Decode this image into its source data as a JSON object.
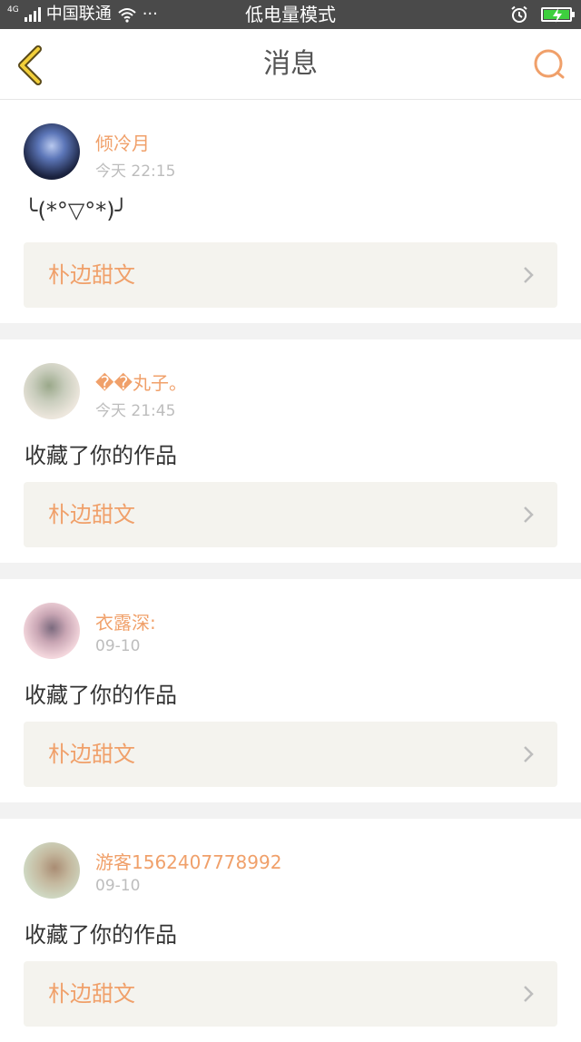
{
  "status_bar": {
    "network": "4G",
    "carrier": "中国联通",
    "dots": "···",
    "mode": "低电量模式"
  },
  "header": {
    "title": "消息"
  },
  "messages": [
    {
      "user": "倾冷月",
      "time": "今天 22:15",
      "text": "╰(*°▽°*)╯",
      "work_title": "朴边甜文",
      "avatar_colors": [
        "#1b2340",
        "#6f88c9"
      ]
    },
    {
      "user": "��丸子。",
      "time": "今天 21:45",
      "text": "收藏了你的作品",
      "work_title": "朴边甜文",
      "avatar_colors": [
        "#e9e1d7",
        "#9aa88a"
      ]
    },
    {
      "user": "衣露深:",
      "time": "09-10",
      "text": "收藏了你的作品",
      "work_title": "朴边甜文",
      "avatar_colors": [
        "#f3d6dc",
        "#7b6a7e"
      ]
    },
    {
      "user": "游客1562407778992",
      "time": "09-10",
      "text": "收藏了你的作品",
      "work_title": "朴边甜文",
      "avatar_colors": [
        "#cfd8c2",
        "#a98c73"
      ]
    }
  ],
  "colors": {
    "accent": "#f0a06a",
    "status_bar": "#4a4a4a",
    "card_bg": "#f4f3ee"
  }
}
